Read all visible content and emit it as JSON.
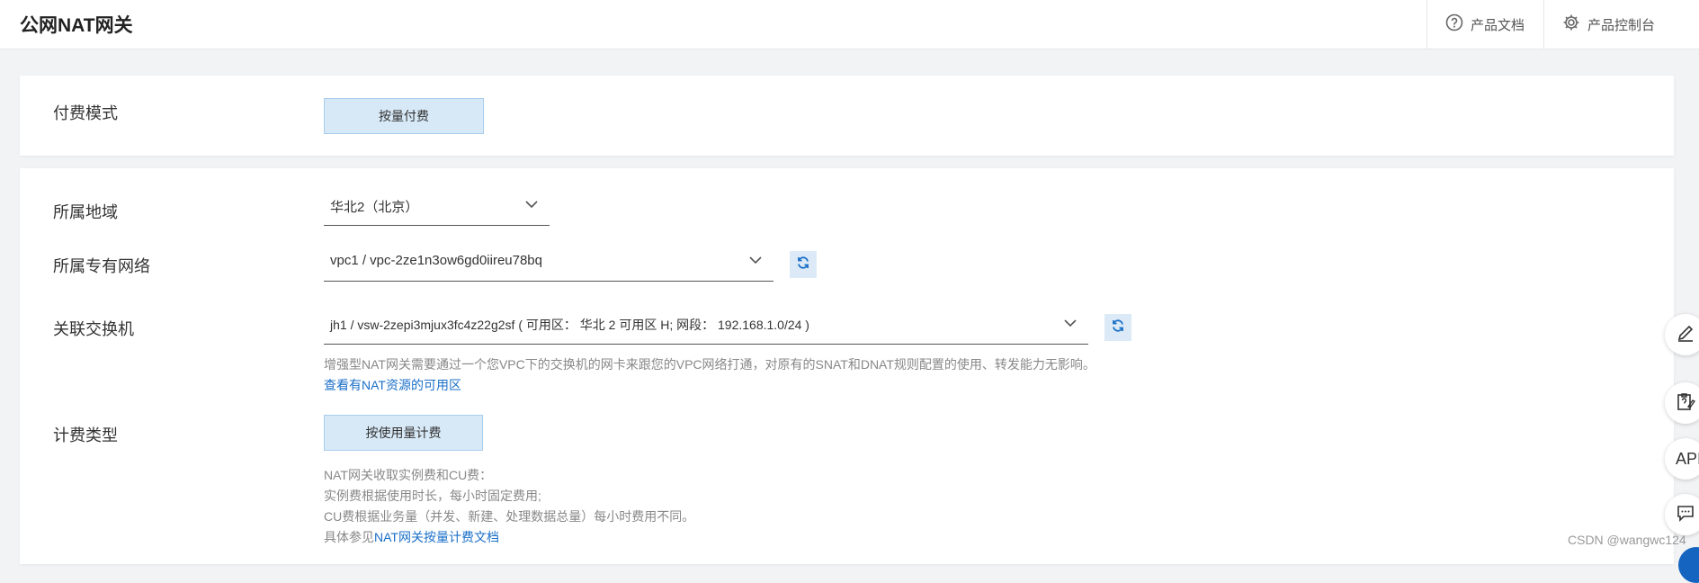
{
  "header": {
    "title": "公网NAT网关",
    "links": [
      {
        "label": "产品文档",
        "icon": "help-circle-icon"
      },
      {
        "label": "产品控制台",
        "icon": "gear-icon"
      }
    ]
  },
  "billing_mode": {
    "label": "付费模式",
    "option": "按量付费"
  },
  "region": {
    "label": "所属地域",
    "value": "华北2（北京）"
  },
  "vpc": {
    "label": "所属专有网络",
    "value": "vpc1 / vpc-2ze1n3ow6gd0iireu78bq"
  },
  "vswitch": {
    "label": "关联交换机",
    "value": "jh1 / vsw-2zepi3mjux3fc4z22g2sf ( 可用区： 华北 2 可用区 H; 网段： 192.168.1.0/24 )",
    "hint": "增强型NAT网关需要通过一个您VPC下的交换机的网卡来跟您的VPC网络打通，对原有的SNAT和DNAT规则配置的使用、转发能力无影响。",
    "link": "查看有NAT资源的可用区"
  },
  "charge_type": {
    "label": "计费类型",
    "option": "按使用量计费",
    "notes": [
      "NAT网关收取实例费和CU费：",
      "实例费根据使用时长，每小时固定费用;",
      "CU费根据业务量（并发、新建、处理数据总量）每小时费用不同。"
    ],
    "doc_prefix": "具体参见",
    "doc_link": "NAT网关按量计费文档"
  },
  "side_tools": [
    "edit-icon",
    "clipboard-question-icon",
    "API",
    "chat-icon"
  ],
  "side_api_label": "API",
  "watermark": "CSDN @wangwc124",
  "colors": {
    "accent": "#1a6fc8",
    "selected_bg": "#d7e9f7"
  }
}
